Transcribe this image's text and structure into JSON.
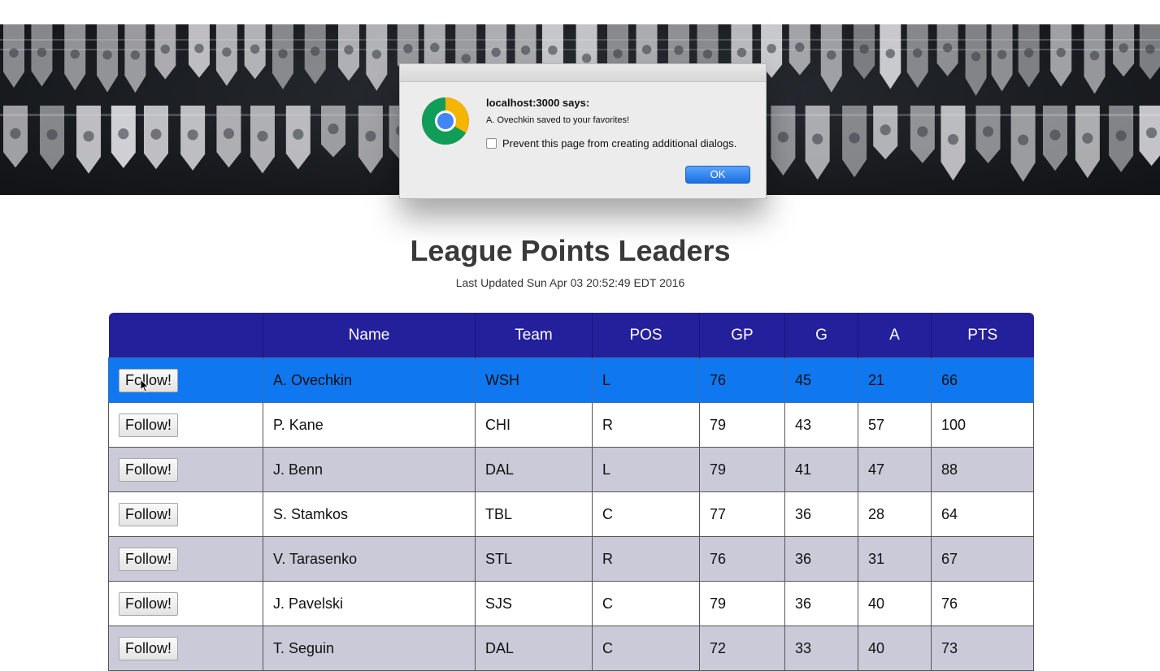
{
  "page": {
    "title": "League Points Leaders",
    "last_updated": "Last Updated Sun Apr 03 20:52:49 EDT 2016"
  },
  "table": {
    "columns": [
      "",
      "Name",
      "Team",
      "POS",
      "GP",
      "G",
      "A",
      "PTS"
    ],
    "follow_label": "Follow!",
    "selected_row": 0,
    "rows": [
      {
        "name": "A. Ovechkin",
        "team": "WSH",
        "pos": "L",
        "gp": "76",
        "g": "45",
        "a": "21",
        "pts": "66"
      },
      {
        "name": "P. Kane",
        "team": "CHI",
        "pos": "R",
        "gp": "79",
        "g": "43",
        "a": "57",
        "pts": "100"
      },
      {
        "name": "J. Benn",
        "team": "DAL",
        "pos": "L",
        "gp": "79",
        "g": "41",
        "a": "47",
        "pts": "88"
      },
      {
        "name": "S. Stamkos",
        "team": "TBL",
        "pos": "C",
        "gp": "77",
        "g": "36",
        "a": "28",
        "pts": "64"
      },
      {
        "name": "V. Tarasenko",
        "team": "STL",
        "pos": "R",
        "gp": "76",
        "g": "36",
        "a": "31",
        "pts": "67"
      },
      {
        "name": "J. Pavelski",
        "team": "SJS",
        "pos": "C",
        "gp": "79",
        "g": "36",
        "a": "40",
        "pts": "76"
      },
      {
        "name": "T. Seguin",
        "team": "DAL",
        "pos": "C",
        "gp": "72",
        "g": "33",
        "a": "40",
        "pts": "73"
      }
    ]
  },
  "dialog": {
    "origin": "localhost:3000 says:",
    "message": "A. Ovechkin saved to your favorites!",
    "checkbox_label": "Prevent this page from creating additional dialogs.",
    "ok_label": "OK",
    "icon": "chrome-logo-icon"
  },
  "colors": {
    "header_bg": "#24209c",
    "selected_row_bg": "#0f77f0",
    "alt_row_bg": "#cbcad8",
    "ok_button": "#1a6fe4"
  }
}
